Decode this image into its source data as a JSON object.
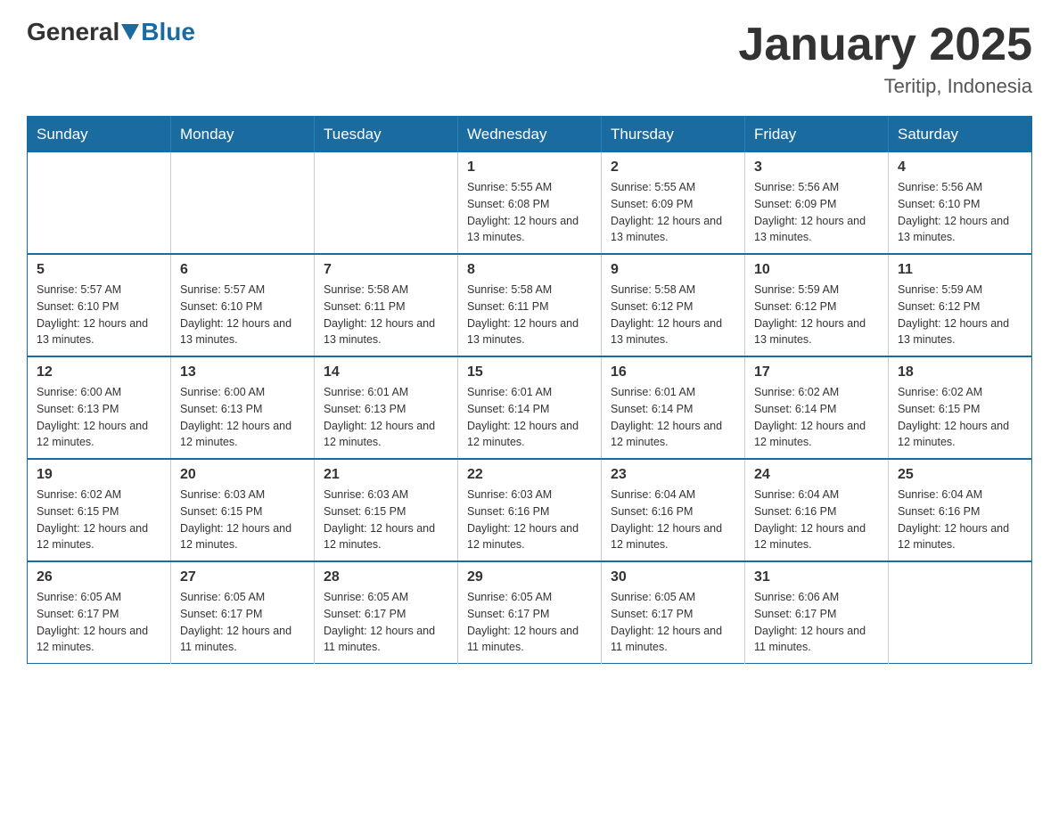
{
  "header": {
    "logo_general": "General",
    "logo_blue": "Blue",
    "month_title": "January 2025",
    "location": "Teritip, Indonesia"
  },
  "weekdays": [
    "Sunday",
    "Monday",
    "Tuesday",
    "Wednesday",
    "Thursday",
    "Friday",
    "Saturday"
  ],
  "weeks": [
    [
      {
        "day": "",
        "sunrise": "",
        "sunset": "",
        "daylight": ""
      },
      {
        "day": "",
        "sunrise": "",
        "sunset": "",
        "daylight": ""
      },
      {
        "day": "",
        "sunrise": "",
        "sunset": "",
        "daylight": ""
      },
      {
        "day": "1",
        "sunrise": "Sunrise: 5:55 AM",
        "sunset": "Sunset: 6:08 PM",
        "daylight": "Daylight: 12 hours and 13 minutes."
      },
      {
        "day": "2",
        "sunrise": "Sunrise: 5:55 AM",
        "sunset": "Sunset: 6:09 PM",
        "daylight": "Daylight: 12 hours and 13 minutes."
      },
      {
        "day": "3",
        "sunrise": "Sunrise: 5:56 AM",
        "sunset": "Sunset: 6:09 PM",
        "daylight": "Daylight: 12 hours and 13 minutes."
      },
      {
        "day": "4",
        "sunrise": "Sunrise: 5:56 AM",
        "sunset": "Sunset: 6:10 PM",
        "daylight": "Daylight: 12 hours and 13 minutes."
      }
    ],
    [
      {
        "day": "5",
        "sunrise": "Sunrise: 5:57 AM",
        "sunset": "Sunset: 6:10 PM",
        "daylight": "Daylight: 12 hours and 13 minutes."
      },
      {
        "day": "6",
        "sunrise": "Sunrise: 5:57 AM",
        "sunset": "Sunset: 6:10 PM",
        "daylight": "Daylight: 12 hours and 13 minutes."
      },
      {
        "day": "7",
        "sunrise": "Sunrise: 5:58 AM",
        "sunset": "Sunset: 6:11 PM",
        "daylight": "Daylight: 12 hours and 13 minutes."
      },
      {
        "day": "8",
        "sunrise": "Sunrise: 5:58 AM",
        "sunset": "Sunset: 6:11 PM",
        "daylight": "Daylight: 12 hours and 13 minutes."
      },
      {
        "day": "9",
        "sunrise": "Sunrise: 5:58 AM",
        "sunset": "Sunset: 6:12 PM",
        "daylight": "Daylight: 12 hours and 13 minutes."
      },
      {
        "day": "10",
        "sunrise": "Sunrise: 5:59 AM",
        "sunset": "Sunset: 6:12 PM",
        "daylight": "Daylight: 12 hours and 13 minutes."
      },
      {
        "day": "11",
        "sunrise": "Sunrise: 5:59 AM",
        "sunset": "Sunset: 6:12 PM",
        "daylight": "Daylight: 12 hours and 13 minutes."
      }
    ],
    [
      {
        "day": "12",
        "sunrise": "Sunrise: 6:00 AM",
        "sunset": "Sunset: 6:13 PM",
        "daylight": "Daylight: 12 hours and 12 minutes."
      },
      {
        "day": "13",
        "sunrise": "Sunrise: 6:00 AM",
        "sunset": "Sunset: 6:13 PM",
        "daylight": "Daylight: 12 hours and 12 minutes."
      },
      {
        "day": "14",
        "sunrise": "Sunrise: 6:01 AM",
        "sunset": "Sunset: 6:13 PM",
        "daylight": "Daylight: 12 hours and 12 minutes."
      },
      {
        "day": "15",
        "sunrise": "Sunrise: 6:01 AM",
        "sunset": "Sunset: 6:14 PM",
        "daylight": "Daylight: 12 hours and 12 minutes."
      },
      {
        "day": "16",
        "sunrise": "Sunrise: 6:01 AM",
        "sunset": "Sunset: 6:14 PM",
        "daylight": "Daylight: 12 hours and 12 minutes."
      },
      {
        "day": "17",
        "sunrise": "Sunrise: 6:02 AM",
        "sunset": "Sunset: 6:14 PM",
        "daylight": "Daylight: 12 hours and 12 minutes."
      },
      {
        "day": "18",
        "sunrise": "Sunrise: 6:02 AM",
        "sunset": "Sunset: 6:15 PM",
        "daylight": "Daylight: 12 hours and 12 minutes."
      }
    ],
    [
      {
        "day": "19",
        "sunrise": "Sunrise: 6:02 AM",
        "sunset": "Sunset: 6:15 PM",
        "daylight": "Daylight: 12 hours and 12 minutes."
      },
      {
        "day": "20",
        "sunrise": "Sunrise: 6:03 AM",
        "sunset": "Sunset: 6:15 PM",
        "daylight": "Daylight: 12 hours and 12 minutes."
      },
      {
        "day": "21",
        "sunrise": "Sunrise: 6:03 AM",
        "sunset": "Sunset: 6:15 PM",
        "daylight": "Daylight: 12 hours and 12 minutes."
      },
      {
        "day": "22",
        "sunrise": "Sunrise: 6:03 AM",
        "sunset": "Sunset: 6:16 PM",
        "daylight": "Daylight: 12 hours and 12 minutes."
      },
      {
        "day": "23",
        "sunrise": "Sunrise: 6:04 AM",
        "sunset": "Sunset: 6:16 PM",
        "daylight": "Daylight: 12 hours and 12 minutes."
      },
      {
        "day": "24",
        "sunrise": "Sunrise: 6:04 AM",
        "sunset": "Sunset: 6:16 PM",
        "daylight": "Daylight: 12 hours and 12 minutes."
      },
      {
        "day": "25",
        "sunrise": "Sunrise: 6:04 AM",
        "sunset": "Sunset: 6:16 PM",
        "daylight": "Daylight: 12 hours and 12 minutes."
      }
    ],
    [
      {
        "day": "26",
        "sunrise": "Sunrise: 6:05 AM",
        "sunset": "Sunset: 6:17 PM",
        "daylight": "Daylight: 12 hours and 12 minutes."
      },
      {
        "day": "27",
        "sunrise": "Sunrise: 6:05 AM",
        "sunset": "Sunset: 6:17 PM",
        "daylight": "Daylight: 12 hours and 11 minutes."
      },
      {
        "day": "28",
        "sunrise": "Sunrise: 6:05 AM",
        "sunset": "Sunset: 6:17 PM",
        "daylight": "Daylight: 12 hours and 11 minutes."
      },
      {
        "day": "29",
        "sunrise": "Sunrise: 6:05 AM",
        "sunset": "Sunset: 6:17 PM",
        "daylight": "Daylight: 12 hours and 11 minutes."
      },
      {
        "day": "30",
        "sunrise": "Sunrise: 6:05 AM",
        "sunset": "Sunset: 6:17 PM",
        "daylight": "Daylight: 12 hours and 11 minutes."
      },
      {
        "day": "31",
        "sunrise": "Sunrise: 6:06 AM",
        "sunset": "Sunset: 6:17 PM",
        "daylight": "Daylight: 12 hours and 11 minutes."
      },
      {
        "day": "",
        "sunrise": "",
        "sunset": "",
        "daylight": ""
      }
    ]
  ]
}
